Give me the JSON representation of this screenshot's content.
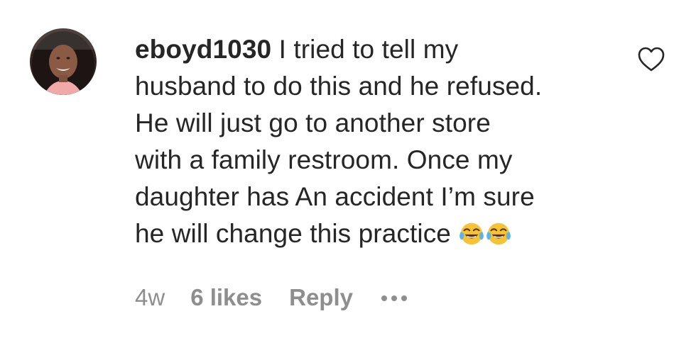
{
  "comment": {
    "username": "eboyd1030",
    "text_lines": [
      "I tried to tell my",
      "husband to do this and he refused.",
      "He will just go to another store",
      "with a family restroom. Once my",
      "daughter has An accident I’m sure",
      "he will change this practice"
    ],
    "emoji_icons": [
      "face-with-tears-of-joy-icon",
      "face-with-tears-of-joy-icon"
    ],
    "time": "4w",
    "likes": "6 likes",
    "reply_label": "Reply"
  },
  "icons": {
    "like": "heart-outline-icon",
    "more": "more-options-icon",
    "avatar": "profile-photo"
  },
  "colors": {
    "text": "#262626",
    "secondary": "#8e8e8e",
    "background": "#ffffff"
  }
}
